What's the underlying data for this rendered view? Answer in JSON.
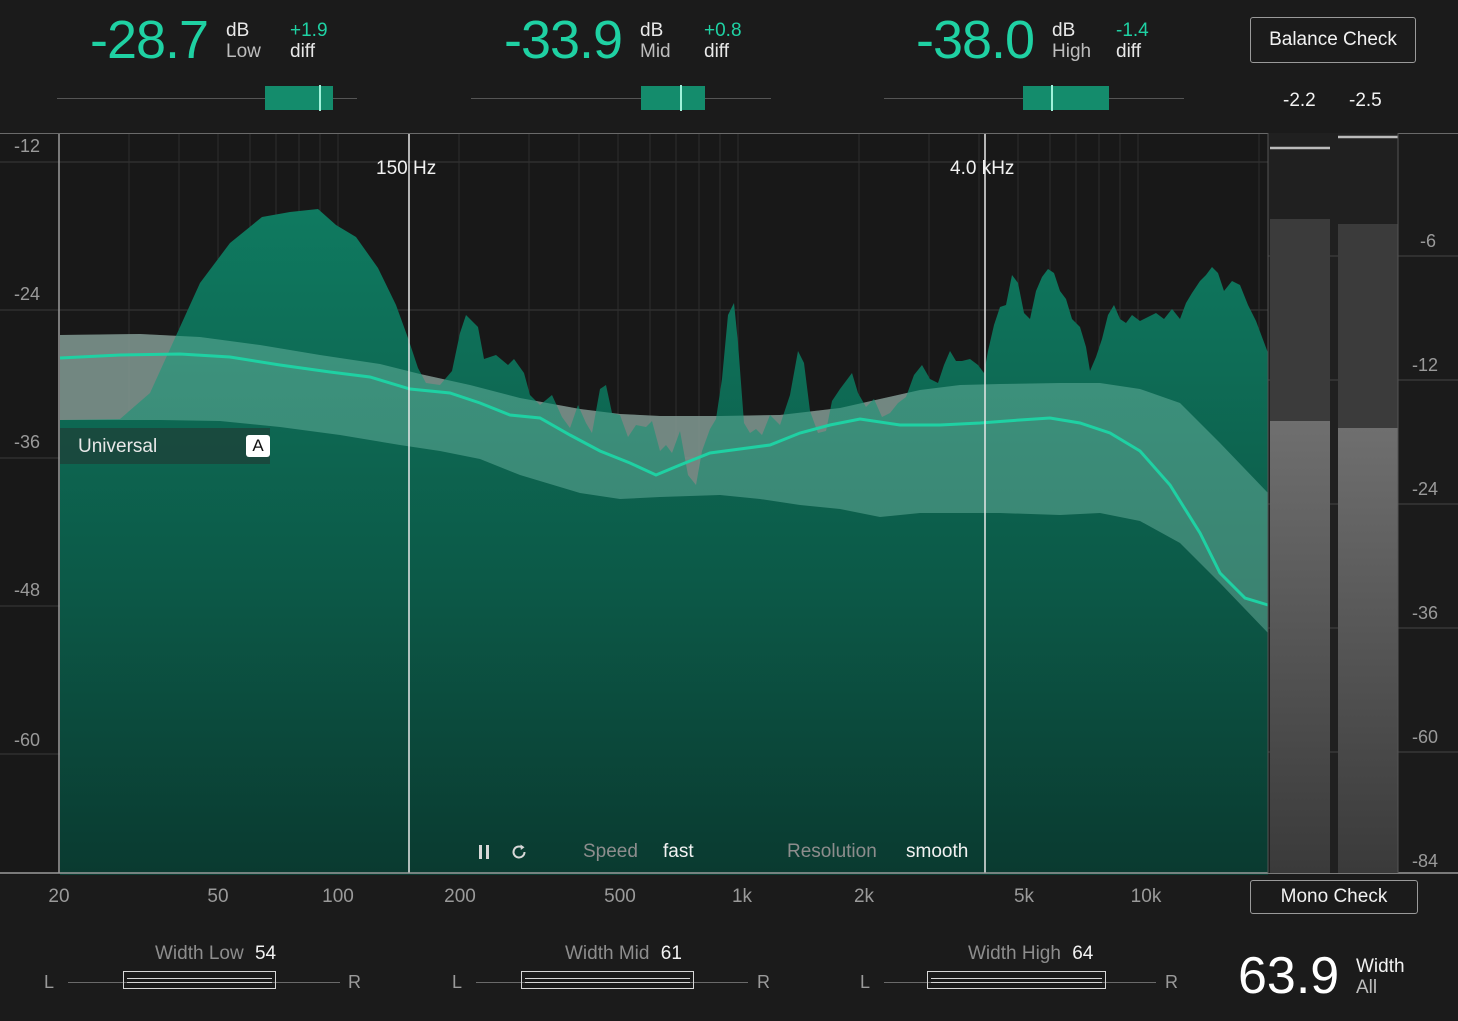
{
  "bands": [
    {
      "value": "-28.7",
      "unit": "dB",
      "name": "Low",
      "diff": "+1.9",
      "diff_label": "diff"
    },
    {
      "value": "-33.9",
      "unit": "dB",
      "name": "Mid",
      "diff": "+0.8",
      "diff_label": "diff"
    },
    {
      "value": "-38.0",
      "unit": "dB",
      "name": "High",
      "diff": "-1.4",
      "diff_label": "diff"
    }
  ],
  "balance_check_label": "Balance Check",
  "mono_check_label": "Mono Check",
  "peak": {
    "left": "-2.2",
    "right": "-2.5"
  },
  "y_axis_left": [
    "-12",
    "-24",
    "-36",
    "-48",
    "-60"
  ],
  "y_axis_right": [
    "-6",
    "-12",
    "-24",
    "-36",
    "-60",
    "-84"
  ],
  "x_axis": [
    "20",
    "50",
    "100",
    "200",
    "500",
    "1k",
    "2k",
    "5k",
    "10k"
  ],
  "crossovers": [
    "150 Hz",
    "4.0 kHz"
  ],
  "profile": {
    "name": "Universal",
    "badge": "A"
  },
  "controls": {
    "speed_label": "Speed",
    "speed_value": "fast",
    "resolution_label": "Resolution",
    "resolution_value": "smooth"
  },
  "width_bands": [
    {
      "label": "Width Low",
      "value": "54",
      "l": "L",
      "r": "R"
    },
    {
      "label": "Width Mid",
      "value": "61",
      "l": "L",
      "r": "R"
    },
    {
      "label": "Width High",
      "value": "64",
      "l": "L",
      "r": "R"
    }
  ],
  "width_all": {
    "value": "63.9",
    "label": "Width",
    "sub": "All"
  },
  "colors": {
    "accent": "#1fd1a3",
    "spectrum": "#0e6b55",
    "band": "#7c7c7c",
    "background": "#1b1b1b"
  },
  "icons": [
    "pause-icon",
    "reset-icon"
  ]
}
